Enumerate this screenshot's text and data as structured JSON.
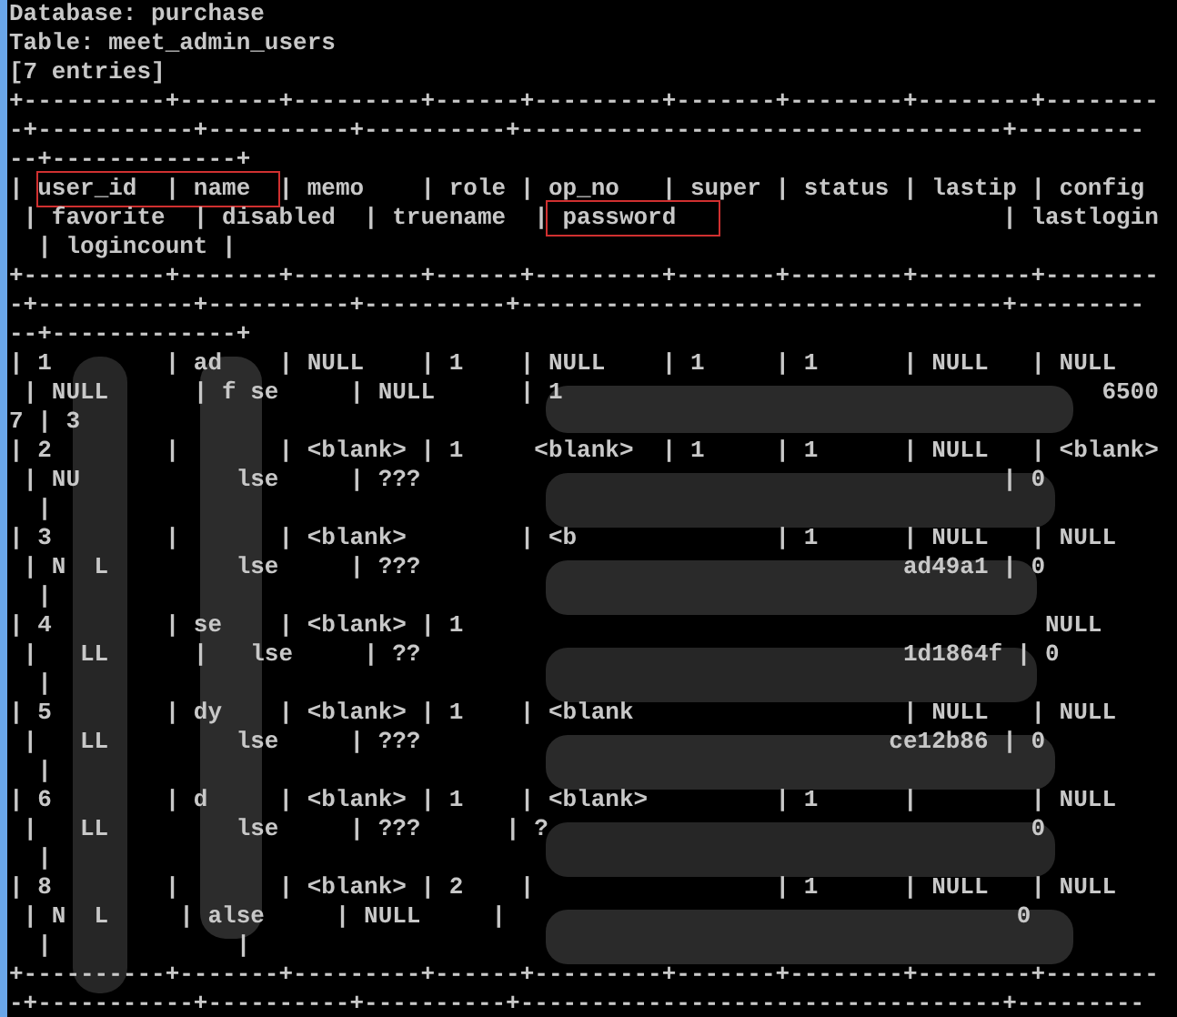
{
  "terminal": {
    "lines": [
      {
        "kind": "text",
        "text": "Database: purchase"
      },
      {
        "kind": "text",
        "text": "Table: meet_admin_users"
      },
      {
        "kind": "text",
        "text": "[7 entries]"
      },
      {
        "kind": "text",
        "text": "+----------+-------+---------+------+---------+-------+--------+--------+--------"
      },
      {
        "kind": "text",
        "text": "-+-----------+----------+----------+----------------------------------+---------"
      },
      {
        "kind": "text",
        "text": "--+-------------+"
      },
      {
        "kind": "marked",
        "parts": [
          {
            "text": "| ",
            "highlighted": false
          },
          {
            "text": "user_id  | name  ",
            "highlighted": true
          },
          {
            "text": "| memo    | role | op_no   | super | status | lastip | config",
            "highlighted": false
          }
        ]
      },
      {
        "kind": "marked",
        "parts": [
          {
            "text": " | favorite  | disabled  | truename  |",
            "highlighted": false
          },
          {
            "text": " password   ",
            "highlighted": true
          },
          {
            "text": "                    | lastlogin",
            "highlighted": false
          }
        ]
      },
      {
        "kind": "text",
        "text": "  | logincount |"
      },
      {
        "kind": "text",
        "text": "+----------+-------+---------+------+---------+-------+--------+--------+--------"
      },
      {
        "kind": "text",
        "text": "-+-----------+----------+----------+----------------------------------+---------"
      },
      {
        "kind": "text",
        "text": "--+-------------+"
      },
      {
        "kind": "text",
        "text": "| 1        | ad    | NULL    | 1    | NULL    | 1     | 1      | NULL   | NULL"
      },
      {
        "kind": "text",
        "text": " | NULL      | f se     | NULL      | 1                                      6500"
      },
      {
        "kind": "text",
        "text": "7 | 3"
      },
      {
        "kind": "text",
        "text": "| 2        |       | <blank> | 1     <blank>  | 1     | 1      | NULL   | <blank>"
      },
      {
        "kind": "text",
        "text": " | NU           lse     | ???                                         | 0"
      },
      {
        "kind": "text",
        "text": "  |"
      },
      {
        "kind": "text",
        "text": "| 3        |       | <blank>        | <b              | 1      | NULL   | NULL"
      },
      {
        "kind": "text",
        "text": " | N  L         lse     | ???                                  ad49a1 | 0"
      },
      {
        "kind": "text",
        "text": "  |"
      },
      {
        "kind": "text",
        "text": "| 4        | se    | <blank> | 1                                         NULL"
      },
      {
        "kind": "text",
        "text": " |   LL      |   lse     | ??                                  1d1864f | 0"
      },
      {
        "kind": "text",
        "text": "  |"
      },
      {
        "kind": "text",
        "text": "| 5        | dy    | <blank> | 1    | <blank                   | NULL   | NULL"
      },
      {
        "kind": "text",
        "text": " |   LL         lse     | ???                                 ce12b86 | 0"
      },
      {
        "kind": "text",
        "text": "  |"
      },
      {
        "kind": "text",
        "text": "| 6        | d     | <blank> | 1    | <blank>         | 1      |        | NULL"
      },
      {
        "kind": "text",
        "text": " |   LL         lse     | ???      | ?                                  0"
      },
      {
        "kind": "text",
        "text": "  |"
      },
      {
        "kind": "text",
        "text": "| 8        |       | <blank> | 2    |                 | 1      | NULL   | NULL"
      },
      {
        "kind": "text",
        "text": " | N  L     | alse     | NULL     |                                    0"
      },
      {
        "kind": "text",
        "text": "  |             |"
      },
      {
        "kind": "text",
        "text": "+----------+-------+---------+------+---------+-------+--------+--------+--------"
      },
      {
        "kind": "text",
        "text": "-+-----------+----------+----------+----------------------------------+---------"
      }
    ]
  }
}
